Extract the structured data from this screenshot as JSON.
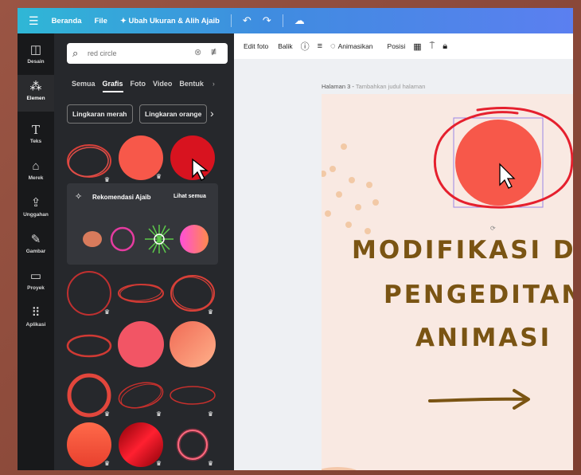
{
  "topbar": {
    "menu_icon": "menu-icon",
    "home": "Beranda",
    "file": "File",
    "resize": "✦ Ubah Ukuran & Alih Ajaib",
    "undo_icon": "undo-icon",
    "redo_icon": "redo-icon",
    "cloud_icon": "cloud-icon"
  },
  "rail": {
    "items": [
      {
        "label": "Desain",
        "icon": "design-icon"
      },
      {
        "label": "Elemen",
        "icon": "elements-icon"
      },
      {
        "label": "Teks",
        "icon": "text-icon"
      },
      {
        "label": "Merek",
        "icon": "brand-icon"
      },
      {
        "label": "Unggahan",
        "icon": "upload-icon"
      },
      {
        "label": "Gambar",
        "icon": "draw-icon"
      },
      {
        "label": "Proyek",
        "icon": "folder-icon"
      },
      {
        "label": "Aplikasi",
        "icon": "apps-icon"
      }
    ]
  },
  "panel": {
    "search": {
      "value": "",
      "placeholder": "red circle"
    },
    "tabs": [
      "Semua",
      "Grafis",
      "Foto",
      "Video",
      "Bentuk"
    ],
    "chips": [
      "Lingkaran merah",
      "Lingkaran orange"
    ],
    "recommend": {
      "title": "Rekomendasi Ajaib",
      "see_all": "Lihat semua"
    }
  },
  "toolbar": {
    "edit_photo": "Edit foto",
    "flip": "Balik",
    "animate": "Animasikan",
    "position": "Posisi"
  },
  "page": {
    "label": "Halaman 3 -",
    "sublabel": "Tambahkan judul halaman"
  },
  "canvas": {
    "line1": "MODIFIKASI DAN",
    "line2": "PENGEDITAN",
    "line3": "ANIMASI"
  },
  "colors": {
    "accent_red": "#e5202e",
    "circle": "#f7584a",
    "heading": "#7a5413",
    "topbar_start": "#2fb7d6",
    "topbar_end": "#5b7ff0"
  }
}
